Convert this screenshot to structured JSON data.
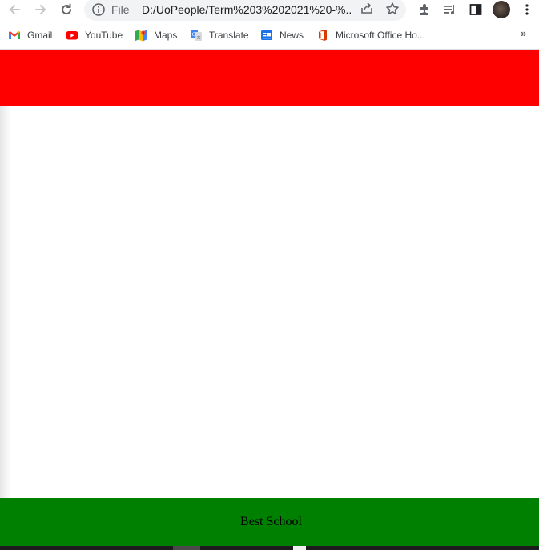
{
  "browser": {
    "omnibox": {
      "scheme_label": "File",
      "url": "D:/UoPeople/Term%203%202021%20-%..."
    },
    "bookmarks": [
      {
        "label": "Gmail",
        "icon": "gmail-icon"
      },
      {
        "label": "YouTube",
        "icon": "youtube-icon"
      },
      {
        "label": "Maps",
        "icon": "maps-icon"
      },
      {
        "label": "Translate",
        "icon": "translate-icon"
      },
      {
        "label": "News",
        "icon": "news-icon"
      },
      {
        "label": "Microsoft Office Ho...",
        "icon": "office-icon"
      }
    ],
    "more_bookmarks": "»"
  },
  "page": {
    "header": {
      "color": "#ff0000"
    },
    "footer": {
      "text": "Best School",
      "color": "#008000"
    }
  },
  "colors": {
    "toolbar_icon": "#5f6368",
    "omnibox_bg": "#f1f3f4"
  }
}
